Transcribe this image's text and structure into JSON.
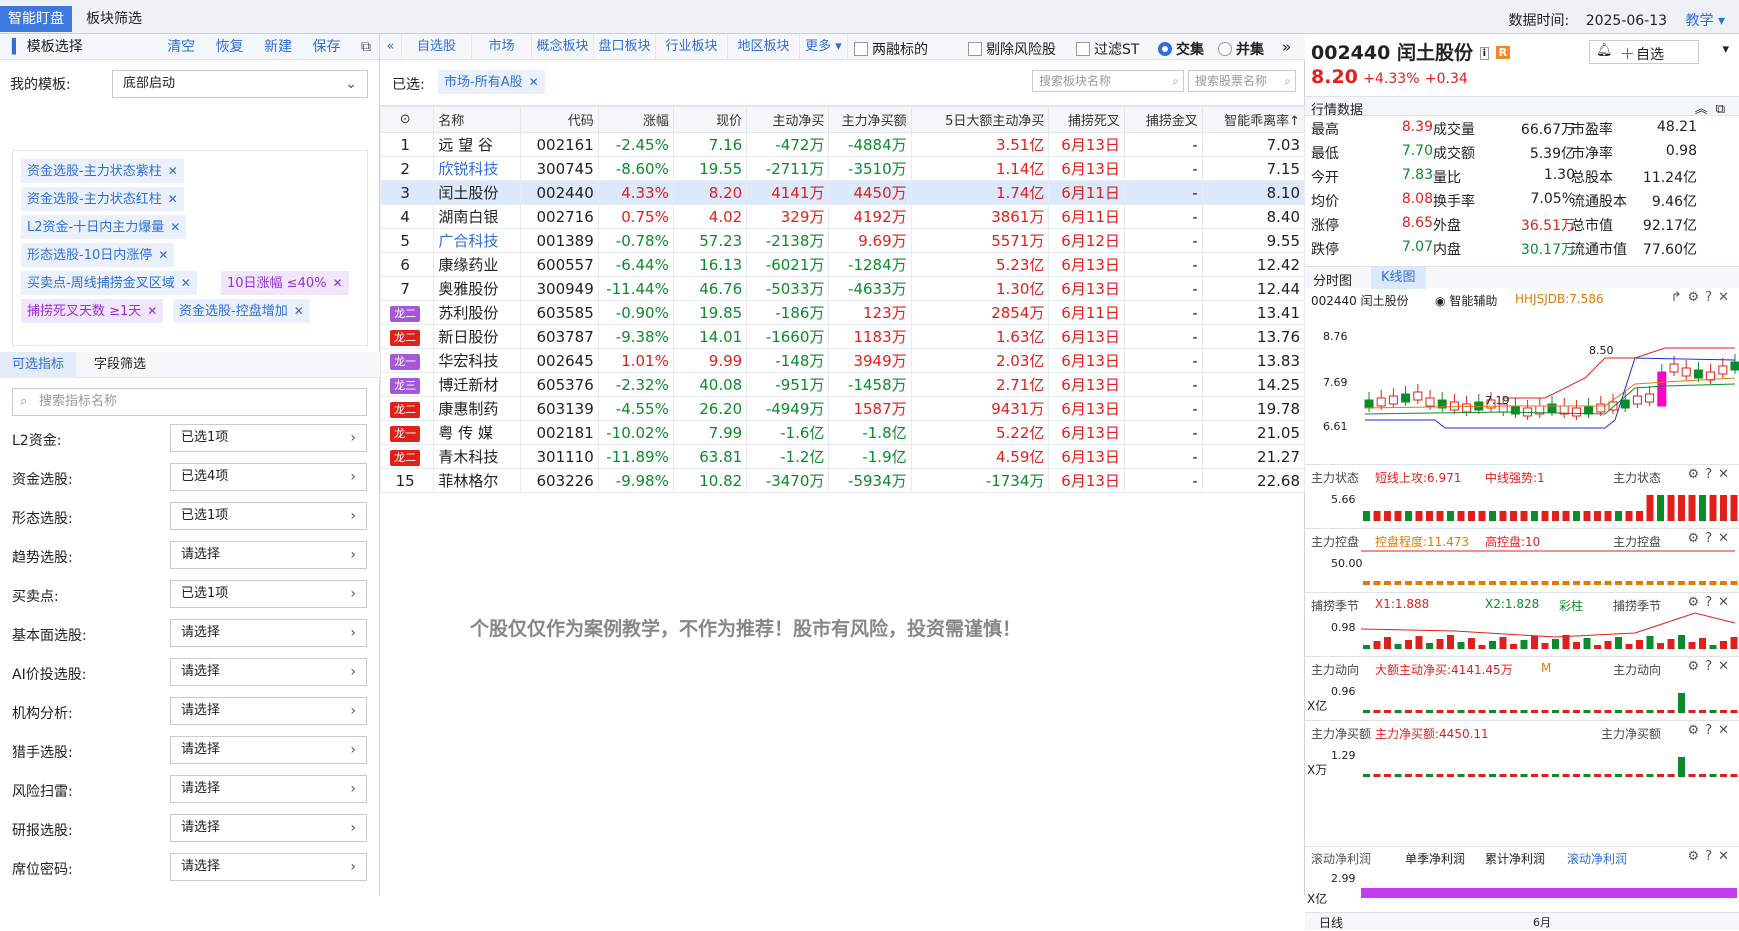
{
  "topbar": {
    "tab1": "智能盯盘",
    "tab2": "板块筛选",
    "data_time_label": "数据时间:",
    "data_time": "2025-06-13",
    "teach": "教学"
  },
  "left": {
    "header": "模板选择",
    "actions": [
      "清空",
      "恢复",
      "新建",
      "保存"
    ],
    "my_template_label": "我的模板:",
    "my_template_value": "底部启动",
    "tags": [
      {
        "text": "资金选股-主力状态紫柱",
        "purple": false
      },
      {
        "text": "资金选股-主力状态红柱",
        "purple": false
      },
      {
        "text": "L2资金-十日内主力爆量",
        "purple": false
      },
      {
        "text": "形态选股-10日内涨停",
        "purple": false
      },
      {
        "text": "买卖点-周线捕捞金叉区域",
        "purple": false
      },
      {
        "text": "10日涨幅 ≤40%",
        "purple": true
      },
      {
        "text": "捕捞死叉天数 ≥1天",
        "purple": true
      },
      {
        "text": "资金选股-控盘增加",
        "purple": false
      }
    ],
    "subtab1": "可选指标",
    "subtab2": "字段筛选",
    "search_placeholder": "搜索指标名称",
    "filters": [
      {
        "label": "L2资金:",
        "value": "已选1项"
      },
      {
        "label": "资金选股:",
        "value": "已选4项"
      },
      {
        "label": "形态选股:",
        "value": "已选1项"
      },
      {
        "label": "趋势选股:",
        "value": "请选择"
      },
      {
        "label": "买卖点:",
        "value": "已选1项"
      },
      {
        "label": "基本面选股:",
        "value": "请选择"
      },
      {
        "label": "AI价投选股:",
        "value": "请选择"
      },
      {
        "label": "机构分析:",
        "value": "请选择"
      },
      {
        "label": "猎手选股:",
        "value": "请选择"
      },
      {
        "label": "风险扫雷:",
        "value": "请选择"
      },
      {
        "label": "研报选股:",
        "value": "请选择"
      },
      {
        "label": "席位密码:",
        "value": "请选择"
      }
    ]
  },
  "center": {
    "toolbar": [
      "自选股",
      "市场",
      "概念板块",
      "盘口板块",
      "行业板块",
      "地区板块",
      "更多"
    ],
    "opt1": "两融标的",
    "opt2": "剔除风险股",
    "opt3": "过滤ST",
    "radio1": "交集",
    "radio2": "并集",
    "selected_label": "已选:",
    "selected_tag": "市场-所有A股",
    "search1": "搜索板块名称",
    "search2": "搜索股票名称",
    "columns": [
      "名称",
      "代码",
      "涨幅",
      "现价",
      "主动净买",
      "主力净买额",
      "5日大额主动净买",
      "捕捞死叉",
      "捕捞金叉",
      "智能乖离率↑"
    ],
    "rows": [
      {
        "idx": "1",
        "badge": "",
        "name": "远 望 谷",
        "code": "002161",
        "chg": "-2.45%",
        "price": "7.16",
        "net": "-472万",
        "main": "-4884万",
        "big5": "3.51亿",
        "death": "6月13日",
        "gold": "-",
        "bias": "7.03",
        "c": "g",
        "nc": "",
        "n1": "g",
        "n2": "g",
        "n3": "r"
      },
      {
        "idx": "2",
        "badge": "",
        "name": "欣锐科技",
        "code": "300745",
        "chg": "-8.60%",
        "price": "19.55",
        "net": "-2711万",
        "main": "-3510万",
        "big5": "1.14亿",
        "death": "6月13日",
        "gold": "-",
        "bias": "7.15",
        "c": "g",
        "nc": "b",
        "n1": "g",
        "n2": "g",
        "n3": "r"
      },
      {
        "idx": "3",
        "badge": "",
        "name": "闰土股份",
        "code": "002440",
        "chg": "4.33%",
        "price": "8.20",
        "net": "4141万",
        "main": "4450万",
        "big5": "1.74亿",
        "death": "6月11日",
        "gold": "-",
        "bias": "8.10",
        "c": "r",
        "nc": "",
        "n1": "r",
        "n2": "r",
        "n3": "r",
        "sel": true
      },
      {
        "idx": "4",
        "badge": "",
        "name": "湖南白银",
        "code": "002716",
        "chg": "0.75%",
        "price": "4.02",
        "net": "329万",
        "main": "4192万",
        "big5": "3861万",
        "death": "6月11日",
        "gold": "-",
        "bias": "8.40",
        "c": "r",
        "nc": "",
        "n1": "r",
        "n2": "r",
        "n3": "r"
      },
      {
        "idx": "5",
        "badge": "",
        "name": "广合科技",
        "code": "001389",
        "chg": "-0.78%",
        "price": "57.23",
        "net": "-2138万",
        "main": "9.69万",
        "big5": "5571万",
        "death": "6月12日",
        "gold": "-",
        "bias": "9.55",
        "c": "g",
        "nc": "b",
        "n1": "g",
        "n2": "r",
        "n3": "r"
      },
      {
        "idx": "6",
        "badge": "",
        "name": "康缘药业",
        "code": "600557",
        "chg": "-6.44%",
        "price": "16.13",
        "net": "-6021万",
        "main": "-1284万",
        "big5": "5.23亿",
        "death": "6月13日",
        "gold": "-",
        "bias": "12.42",
        "c": "g",
        "nc": "",
        "n1": "g",
        "n2": "g",
        "n3": "r"
      },
      {
        "idx": "7",
        "badge": "",
        "name": "奥雅股份",
        "code": "300949",
        "chg": "-11.44%",
        "price": "46.76",
        "net": "-5033万",
        "main": "-4633万",
        "big5": "1.30亿",
        "death": "6月13日",
        "gold": "-",
        "bias": "12.44",
        "c": "g",
        "nc": "",
        "n1": "g",
        "n2": "g",
        "n3": "r"
      },
      {
        "idx": "",
        "badge": "龙二",
        "bc": "pur",
        "name": "苏利股份",
        "code": "603585",
        "chg": "-0.90%",
        "price": "19.85",
        "net": "-186万",
        "main": "123万",
        "big5": "2854万",
        "death": "6月11日",
        "gold": "-",
        "bias": "13.41",
        "c": "g",
        "nc": "",
        "n1": "g",
        "n2": "r",
        "n3": "r"
      },
      {
        "idx": "",
        "badge": "龙二",
        "bc": "red",
        "name": "新日股份",
        "code": "603787",
        "chg": "-9.38%",
        "price": "14.01",
        "net": "-1660万",
        "main": "1183万",
        "big5": "1.63亿",
        "death": "6月13日",
        "gold": "-",
        "bias": "13.76",
        "c": "g",
        "nc": "",
        "n1": "g",
        "n2": "r",
        "n3": "r"
      },
      {
        "idx": "",
        "badge": "龙一",
        "bc": "pur",
        "name": "华宏科技",
        "code": "002645",
        "chg": "1.01%",
        "price": "9.99",
        "net": "-148万",
        "main": "3949万",
        "big5": "2.03亿",
        "death": "6月13日",
        "gold": "-",
        "bias": "13.83",
        "c": "r",
        "nc": "",
        "n1": "g",
        "n2": "r",
        "n3": "r"
      },
      {
        "idx": "",
        "badge": "龙三",
        "bc": "pur",
        "name": "博迁新材",
        "code": "605376",
        "chg": "-2.32%",
        "price": "40.08",
        "net": "-951万",
        "main": "-1458万",
        "big5": "2.71亿",
        "death": "6月13日",
        "gold": "-",
        "bias": "14.25",
        "c": "g",
        "nc": "",
        "n1": "g",
        "n2": "g",
        "n3": "r"
      },
      {
        "idx": "",
        "badge": "龙二",
        "bc": "red",
        "name": "康惠制药",
        "code": "603139",
        "chg": "-4.55%",
        "price": "26.20",
        "net": "-4949万",
        "main": "1587万",
        "big5": "9431万",
        "death": "6月13日",
        "gold": "-",
        "bias": "19.78",
        "c": "g",
        "nc": "",
        "n1": "g",
        "n2": "r",
        "n3": "r"
      },
      {
        "idx": "",
        "badge": "龙一",
        "bc": "red",
        "name": "粤 传 媒",
        "code": "002181",
        "chg": "-10.02%",
        "price": "7.99",
        "net": "-1.6亿",
        "main": "-1.8亿",
        "big5": "5.22亿",
        "death": "6月13日",
        "gold": "-",
        "bias": "21.05",
        "c": "g",
        "nc": "",
        "n1": "g",
        "n2": "g",
        "n3": "r"
      },
      {
        "idx": "",
        "badge": "龙二",
        "bc": "red",
        "name": "青木科技",
        "code": "301110",
        "chg": "-11.89%",
        "price": "63.81",
        "net": "-1.2亿",
        "main": "-1.9亿",
        "big5": "4.59亿",
        "death": "6月13日",
        "gold": "-",
        "bias": "21.27",
        "c": "g",
        "nc": "",
        "n1": "g",
        "n2": "g",
        "n3": "r"
      },
      {
        "idx": "15",
        "badge": "",
        "name": "菲林格尔",
        "code": "603226",
        "chg": "-9.98%",
        "price": "10.82",
        "net": "-3470万",
        "main": "-5934万",
        "big5": "-1734万",
        "death": "6月13日",
        "gold": "-",
        "bias": "22.68",
        "c": "g",
        "nc": "",
        "n1": "g",
        "n2": "g",
        "n3": "g"
      }
    ],
    "disclaimer": "个股仅仅作为案例教学，不作为推荐！股市有风险，投资需谨慎！"
  },
  "right": {
    "code": "002440",
    "name": "闰土股份",
    "price": "8.20",
    "chg": "+4.33%",
    "chg_abs": "+0.34",
    "watch": "自选",
    "quote_header": "行情数据",
    "quotes": [
      [
        "最高",
        "8.39",
        "成交量",
        "66.67万",
        "市盈率",
        "48.21"
      ],
      [
        "最低",
        "7.70",
        "成交额",
        "5.39亿",
        "市净率",
        "0.98"
      ],
      [
        "今开",
        "7.83",
        "量比",
        "1.30",
        "总股本",
        "11.24亿"
      ],
      [
        "均价",
        "8.08",
        "换手率",
        "7.05%",
        "流通股本",
        "9.46亿"
      ],
      [
        "涨停",
        "8.65",
        "外盘",
        "36.51万",
        "总市值",
        "92.17亿"
      ],
      [
        "跌停",
        "7.07",
        "内盘",
        "30.17万",
        "流通市值",
        "77.60亿"
      ]
    ],
    "chart_tab1": "分时图",
    "chart_tab2": "K线图",
    "chart_title": "002440 闰土股份",
    "assist": "智能辅助",
    "hhjs": "HHJSJDB:7.586",
    "kline_high": "8.50",
    "kline_low": "7.19",
    "y_ticks": [
      "8.76",
      "7.69",
      "6.61"
    ],
    "panels": [
      {
        "name": "主力状态",
        "info": "短线上攻:6.971",
        "info2": "中线强势:1",
        "val": "5.66"
      },
      {
        "name": "主力控盘",
        "info": "控盘程度:11.473",
        "info2": "高控盘:10",
        "val": "50.00"
      },
      {
        "name": "捕捞季节",
        "info": "X1:1.888",
        "info2": "X2:1.828",
        "info3": "彩柱",
        "val": "0.98"
      },
      {
        "name": "主力动向",
        "info": "大额主动净买:4141.45万",
        "info2": "M",
        "val": "0.96",
        "unit": "X亿"
      },
      {
        "name": "主力净买额",
        "info": "主力净买额:4450.11",
        "val": "1.29",
        "unit": "X万"
      }
    ],
    "bottom_tabs": [
      "滚动净利润",
      "单季净利润",
      "累计净利润",
      "滚动净利润"
    ],
    "bottom_val": "2.99",
    "bottom_unit": "X亿",
    "period": "日线",
    "month": "6月"
  }
}
